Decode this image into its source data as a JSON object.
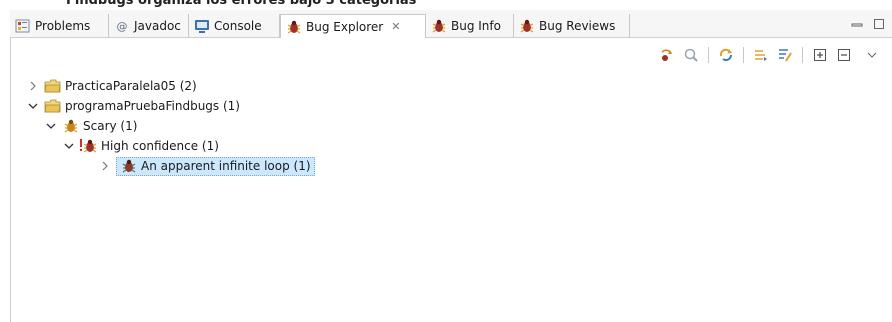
{
  "caption": "Findbugs organiza los errores bajo 3 categorías",
  "tabs": [
    {
      "label": "Problems",
      "icon": "problems-icon"
    },
    {
      "label": "Javadoc",
      "icon": "javadoc-icon"
    },
    {
      "label": "Console",
      "icon": "console-icon"
    },
    {
      "label": "Bug Explorer",
      "icon": "bug-icon",
      "active": true
    },
    {
      "label": "Bug Info",
      "icon": "bug-icon"
    },
    {
      "label": "Bug Reviews",
      "icon": "bug-icon"
    }
  ],
  "toolbar_icons": [
    "go-to-bug-icon",
    "filter-icon",
    "sync-icon",
    "group-icon",
    "filter-bugs-icon",
    "expand-all-icon",
    "collapse-all-icon",
    "view-menu-icon"
  ],
  "tree": [
    {
      "label": "PracticaParalela05 (2)",
      "icon": "folder-icon",
      "expanded": false,
      "level": 0
    },
    {
      "label": "programaPruebaFindbugs (1)",
      "icon": "folder-icon",
      "expanded": true,
      "level": 0
    },
    {
      "label": "Scary (1)",
      "icon": "bug-scary-icon",
      "expanded": true,
      "level": 1
    },
    {
      "label": "High confidence (1)",
      "icon": "bug-high-confidence-icon",
      "expanded": true,
      "level": 2
    },
    {
      "label": "An apparent infinite loop (1)",
      "icon": "bug-icon",
      "expanded": false,
      "level": 3,
      "selected": true
    }
  ],
  "colors": {
    "selection": "#cce8ff",
    "folder": "#e8c45a",
    "bug": "#a0302a"
  }
}
